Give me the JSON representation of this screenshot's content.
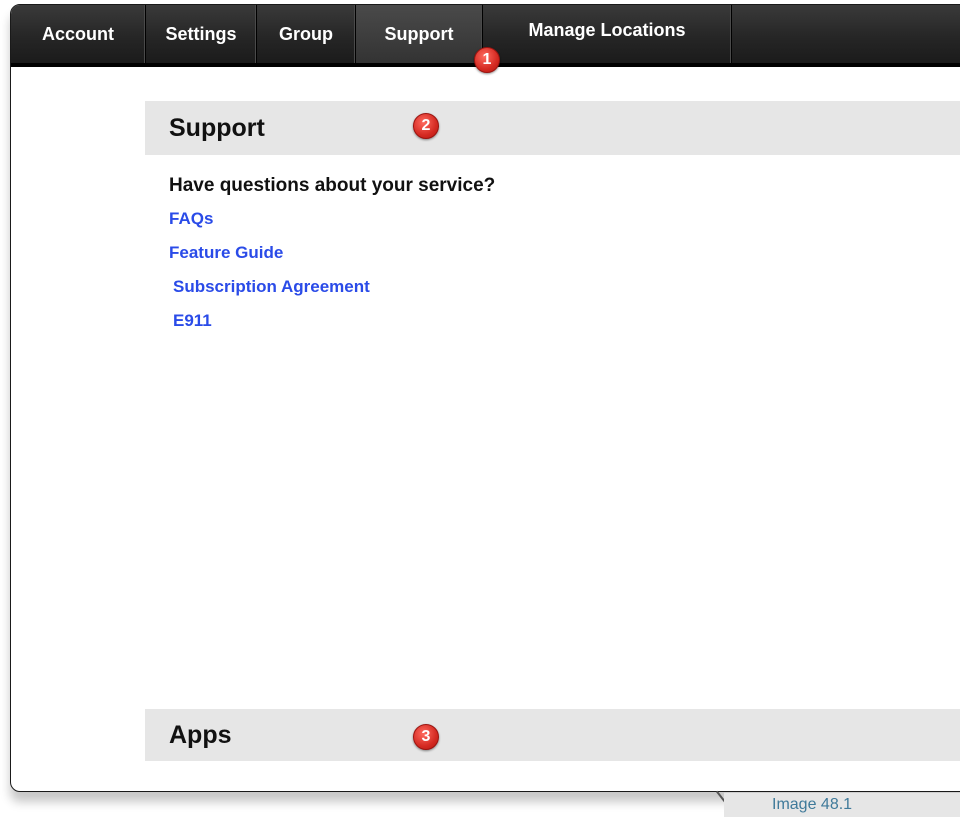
{
  "nav": {
    "tabs": [
      {
        "label": "Account"
      },
      {
        "label": "Settings"
      },
      {
        "label": "Group"
      },
      {
        "label": "Support",
        "active": true
      },
      {
        "label": "Manage Locations"
      }
    ]
  },
  "callouts": [
    "1",
    "2",
    "3"
  ],
  "support": {
    "title": "Support",
    "question": "Have questions about your service?",
    "links": [
      "FAQs",
      "Feature Guide",
      "Subscription Agreement",
      "E911"
    ]
  },
  "apps": {
    "title": "Apps"
  },
  "caption": "Image 48.1",
  "colors": {
    "navbar": "#262626",
    "link": "#2a4be8",
    "badge": "#d42a22",
    "section_header": "#e6e6e6",
    "caption_text": "#3f7a9a"
  }
}
